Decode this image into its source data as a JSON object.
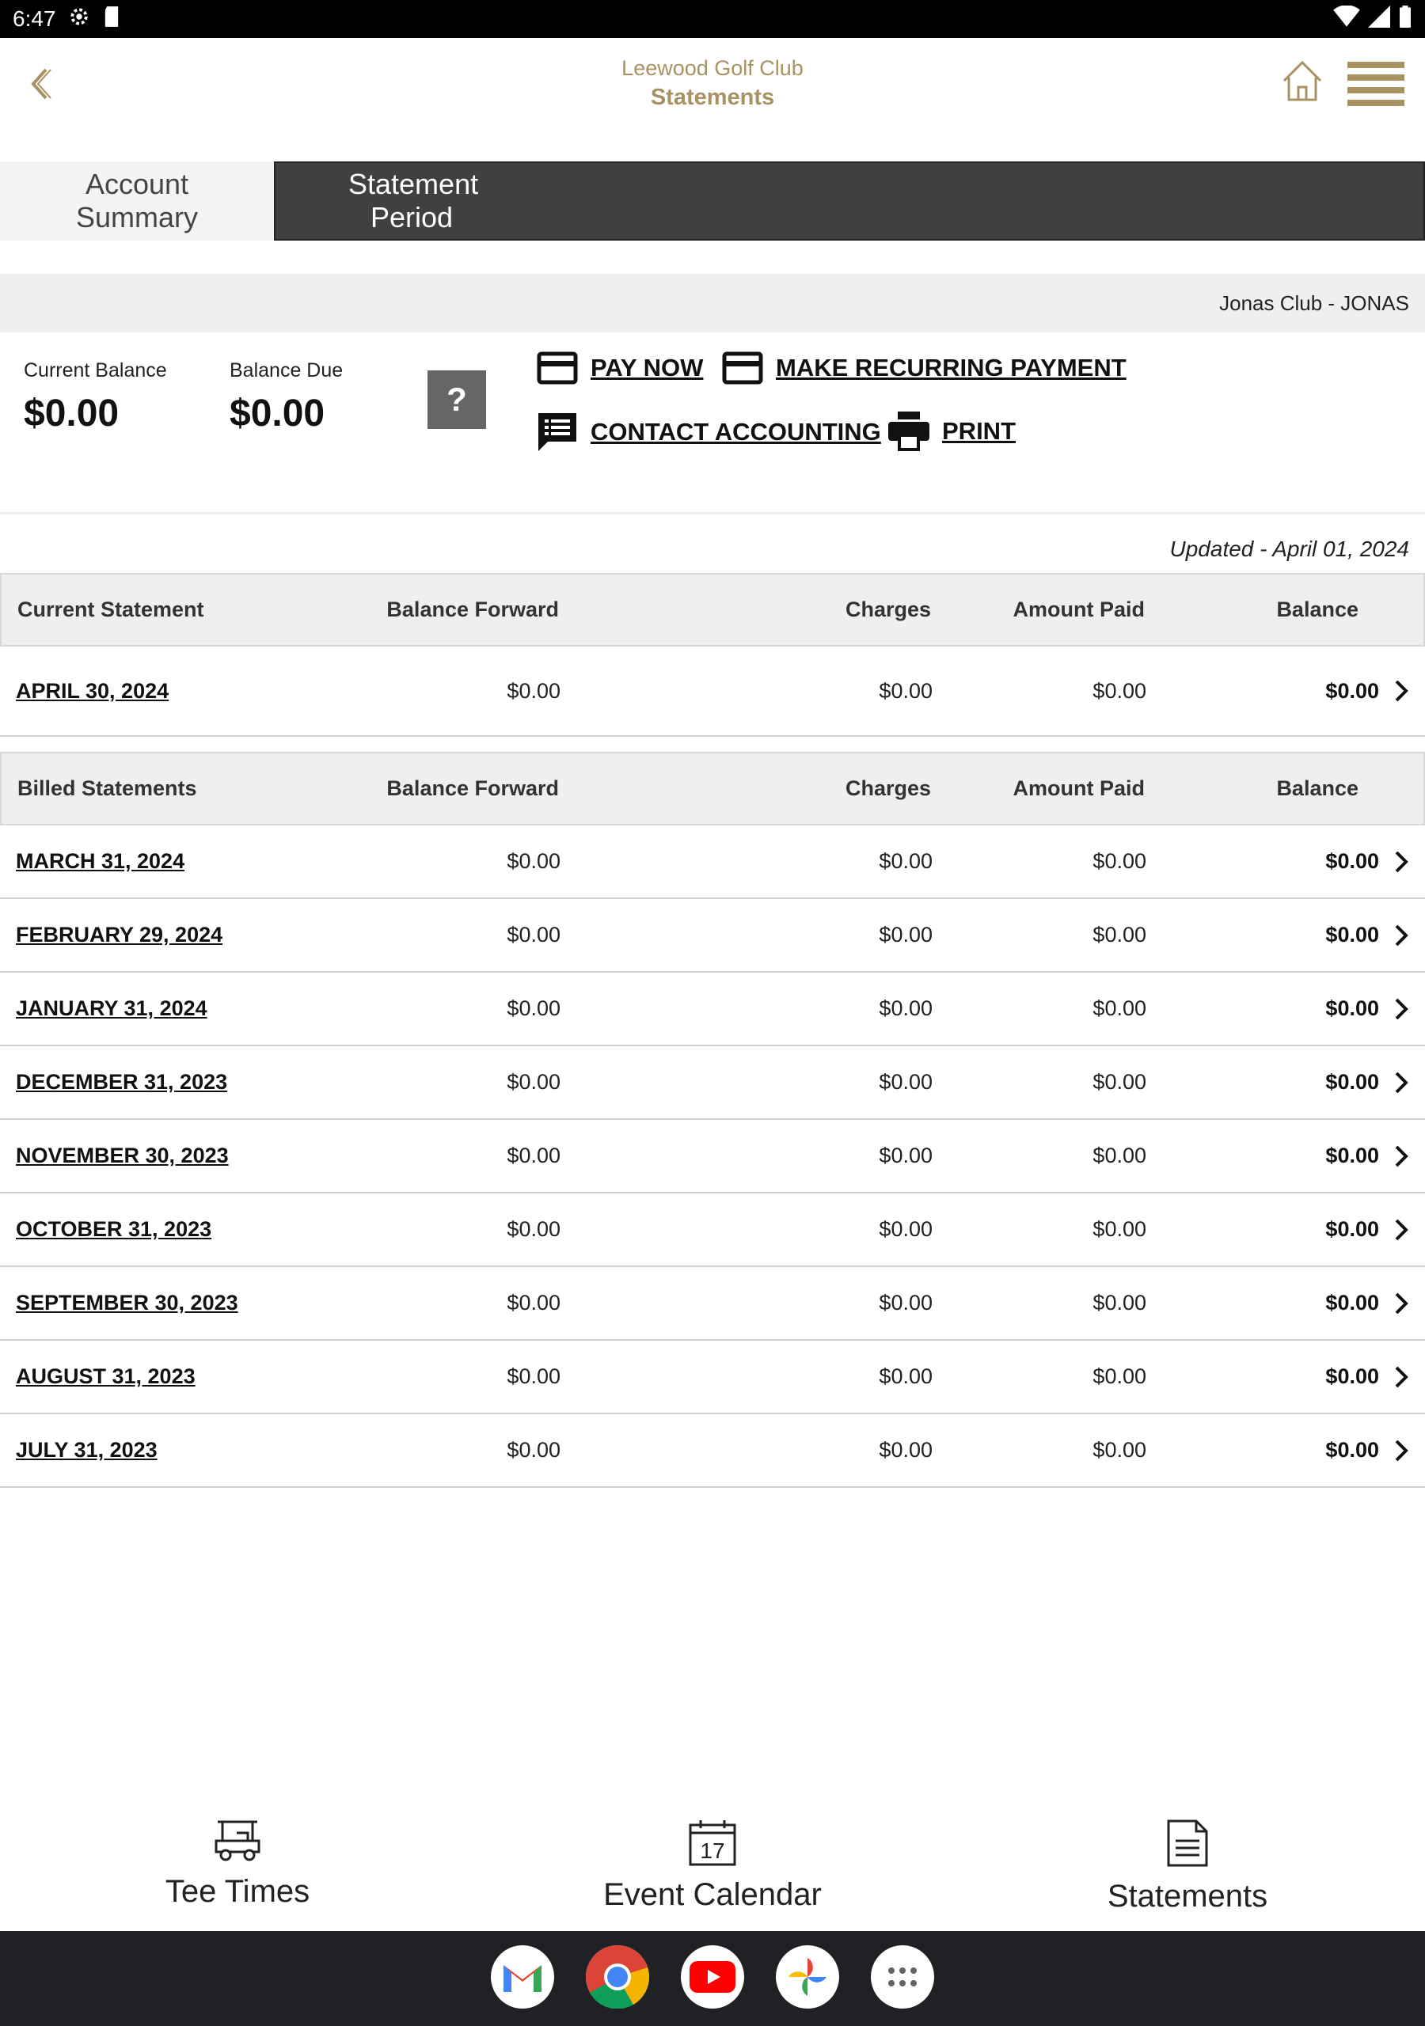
{
  "status_bar": {
    "time": "6:47"
  },
  "header": {
    "club_name": "Leewood Golf Club",
    "title": "Statements"
  },
  "tabs": [
    {
      "label_line1": "Account",
      "label_line2": "Summary"
    },
    {
      "label_line1": "Statement",
      "label_line2": "Period"
    }
  ],
  "club_bar": {
    "label": "Jonas Club - JONAS"
  },
  "balances": {
    "current_label": "Current Balance",
    "current_value": "$0.00",
    "due_label": "Balance Due",
    "due_value": "$0.00",
    "help_label": "?"
  },
  "actions": {
    "pay_now": "PAY NOW",
    "recurring": "MAKE RECURRING PAYMENT",
    "contact": "CONTACT ACCOUNTING",
    "print": "PRINT"
  },
  "updated": "Updated - April 01, 2024",
  "current_table": {
    "headers": [
      "Current Statement",
      "Balance Forward",
      "Charges",
      "Amount Paid",
      "Balance"
    ],
    "rows": [
      {
        "date": "APRIL 30, 2024",
        "forward": "$0.00",
        "charges": "$0.00",
        "paid": "$0.00",
        "balance": "$0.00"
      }
    ]
  },
  "billed_table": {
    "headers": [
      "Billed Statements",
      "Balance Forward",
      "Charges",
      "Amount Paid",
      "Balance"
    ],
    "rows": [
      {
        "date": "MARCH 31, 2024",
        "forward": "$0.00",
        "charges": "$0.00",
        "paid": "$0.00",
        "balance": "$0.00"
      },
      {
        "date": "FEBRUARY 29, 2024",
        "forward": "$0.00",
        "charges": "$0.00",
        "paid": "$0.00",
        "balance": "$0.00"
      },
      {
        "date": "JANUARY 31, 2024",
        "forward": "$0.00",
        "charges": "$0.00",
        "paid": "$0.00",
        "balance": "$0.00"
      },
      {
        "date": "DECEMBER 31, 2023",
        "forward": "$0.00",
        "charges": "$0.00",
        "paid": "$0.00",
        "balance": "$0.00"
      },
      {
        "date": "NOVEMBER 30, 2023",
        "forward": "$0.00",
        "charges": "$0.00",
        "paid": "$0.00",
        "balance": "$0.00"
      },
      {
        "date": "OCTOBER 31, 2023",
        "forward": "$0.00",
        "charges": "$0.00",
        "paid": "$0.00",
        "balance": "$0.00"
      },
      {
        "date": "SEPTEMBER 30, 2023",
        "forward": "$0.00",
        "charges": "$0.00",
        "paid": "$0.00",
        "balance": "$0.00"
      },
      {
        "date": "AUGUST 31, 2023",
        "forward": "$0.00",
        "charges": "$0.00",
        "paid": "$0.00",
        "balance": "$0.00"
      },
      {
        "date": "JULY 31, 2023",
        "forward": "$0.00",
        "charges": "$0.00",
        "paid": "$0.00",
        "balance": "$0.00"
      }
    ]
  },
  "bottom_nav": [
    {
      "label": "Tee Times",
      "icon": "golf-cart-icon"
    },
    {
      "label": "Event Calendar",
      "icon": "calendar-icon",
      "calendar_day": "17"
    },
    {
      "label": "Statements",
      "icon": "document-icon"
    }
  ],
  "dock": [
    "gmail-icon",
    "chrome-icon",
    "youtube-icon",
    "photos-icon",
    "app-drawer-icon"
  ],
  "colors": {
    "accent": "#a89261",
    "tab_active": "#404040",
    "header_row": "#efefef",
    "dock": "#202124"
  }
}
